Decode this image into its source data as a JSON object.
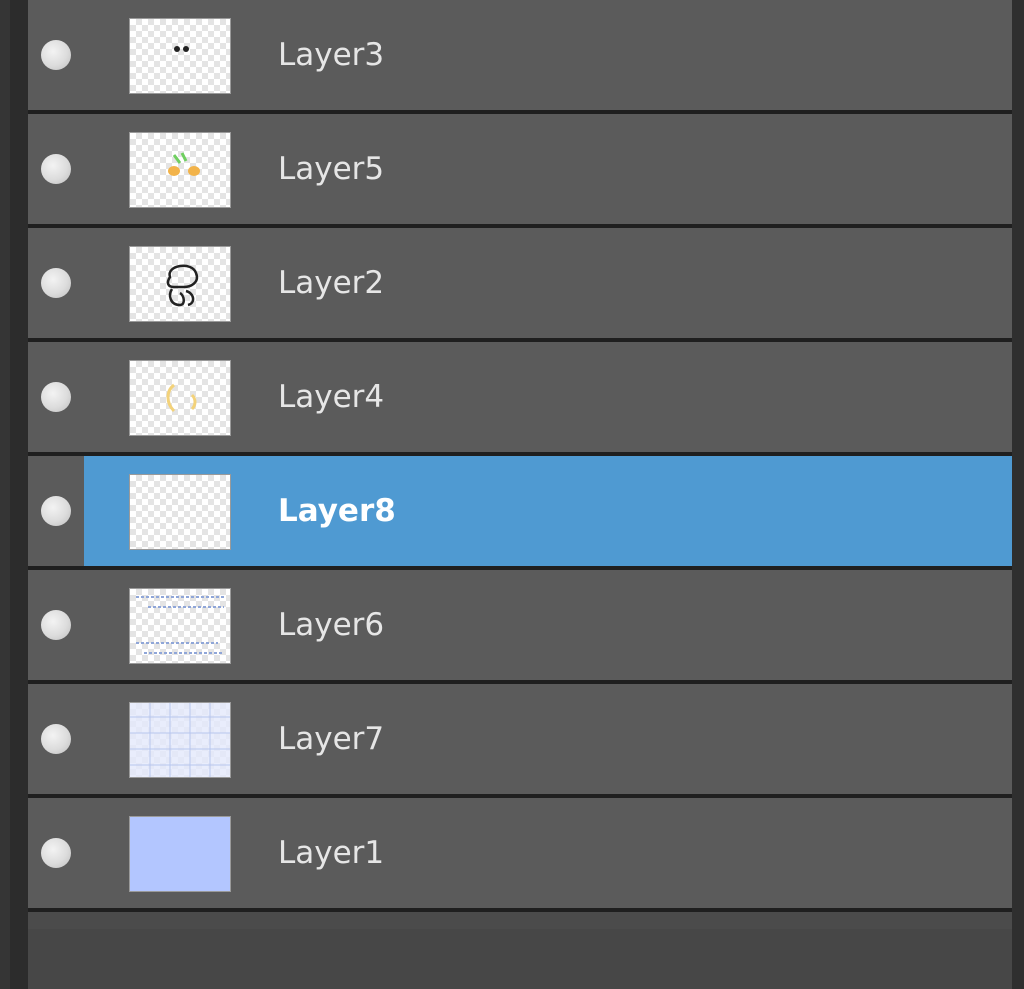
{
  "layers_panel": {
    "layers": [
      {
        "name": "Layer3",
        "selected": false,
        "thumbnail": "eyes-dots"
      },
      {
        "name": "Layer5",
        "selected": false,
        "thumbnail": "orange-green-marks"
      },
      {
        "name": "Layer2",
        "selected": false,
        "thumbnail": "character-lineart"
      },
      {
        "name": "Layer4",
        "selected": false,
        "thumbnail": "yellow-strokes"
      },
      {
        "name": "Layer8",
        "selected": true,
        "thumbnail": "empty"
      },
      {
        "name": "Layer6",
        "selected": false,
        "thumbnail": "blue-text-lines"
      },
      {
        "name": "Layer7",
        "selected": false,
        "thumbnail": "light-blue-pattern"
      },
      {
        "name": "Layer1",
        "selected": false,
        "thumbnail": "solid-fill",
        "fill_color": "#b3c6ff"
      }
    ],
    "colors": {
      "row_bg": "#5b5b5b",
      "selected_bg": "#4f9ad2",
      "separator": "#1f1f1f",
      "label_text": "#e6e6e6",
      "visibility_dot": "#d9d9d9"
    }
  }
}
